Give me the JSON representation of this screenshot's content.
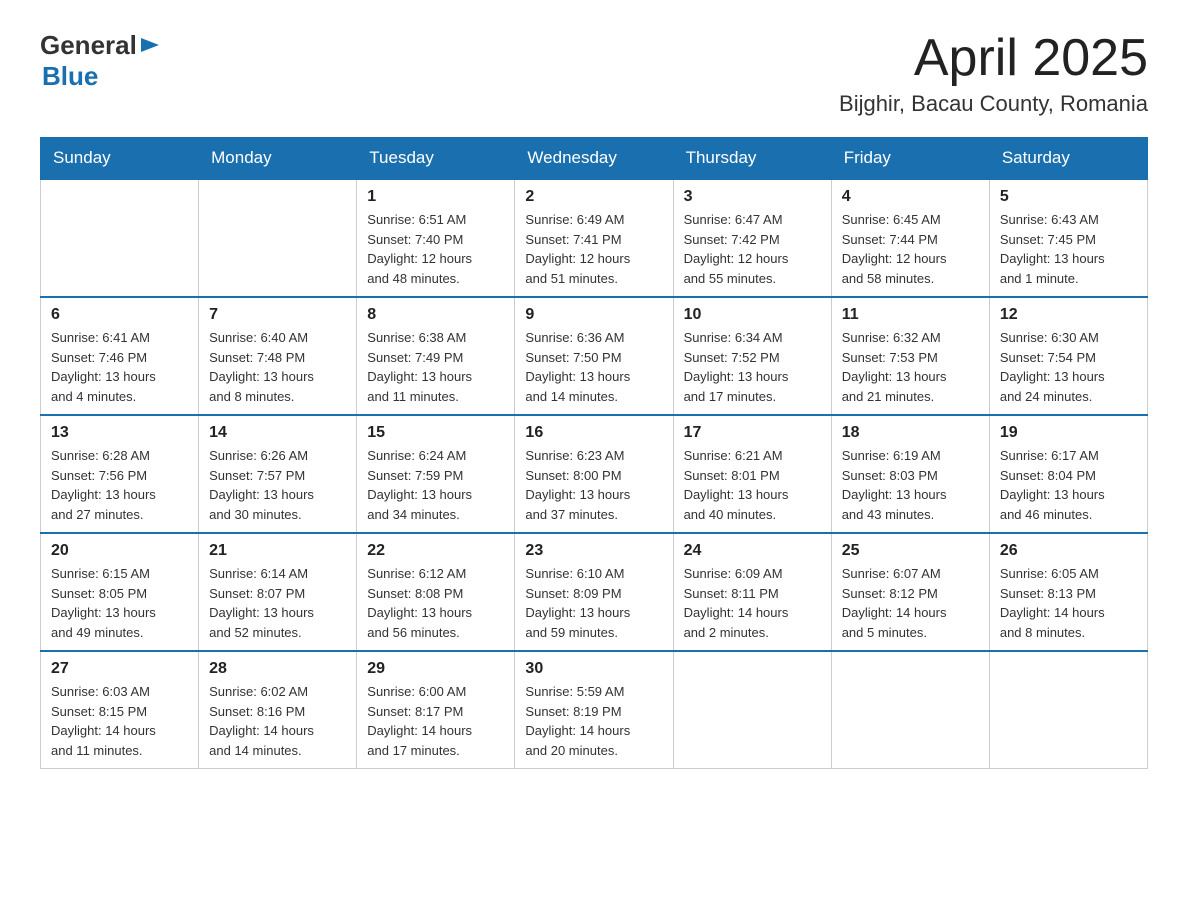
{
  "header": {
    "logo": {
      "general": "General",
      "blue": "Blue"
    },
    "title": "April 2025",
    "location": "Bijghir, Bacau County, Romania"
  },
  "days_of_week": [
    "Sunday",
    "Monday",
    "Tuesday",
    "Wednesday",
    "Thursday",
    "Friday",
    "Saturday"
  ],
  "weeks": [
    {
      "days": [
        {
          "num": "",
          "info": ""
        },
        {
          "num": "",
          "info": ""
        },
        {
          "num": "1",
          "info": "Sunrise: 6:51 AM\nSunset: 7:40 PM\nDaylight: 12 hours\nand 48 minutes."
        },
        {
          "num": "2",
          "info": "Sunrise: 6:49 AM\nSunset: 7:41 PM\nDaylight: 12 hours\nand 51 minutes."
        },
        {
          "num": "3",
          "info": "Sunrise: 6:47 AM\nSunset: 7:42 PM\nDaylight: 12 hours\nand 55 minutes."
        },
        {
          "num": "4",
          "info": "Sunrise: 6:45 AM\nSunset: 7:44 PM\nDaylight: 12 hours\nand 58 minutes."
        },
        {
          "num": "5",
          "info": "Sunrise: 6:43 AM\nSunset: 7:45 PM\nDaylight: 13 hours\nand 1 minute."
        }
      ]
    },
    {
      "days": [
        {
          "num": "6",
          "info": "Sunrise: 6:41 AM\nSunset: 7:46 PM\nDaylight: 13 hours\nand 4 minutes."
        },
        {
          "num": "7",
          "info": "Sunrise: 6:40 AM\nSunset: 7:48 PM\nDaylight: 13 hours\nand 8 minutes."
        },
        {
          "num": "8",
          "info": "Sunrise: 6:38 AM\nSunset: 7:49 PM\nDaylight: 13 hours\nand 11 minutes."
        },
        {
          "num": "9",
          "info": "Sunrise: 6:36 AM\nSunset: 7:50 PM\nDaylight: 13 hours\nand 14 minutes."
        },
        {
          "num": "10",
          "info": "Sunrise: 6:34 AM\nSunset: 7:52 PM\nDaylight: 13 hours\nand 17 minutes."
        },
        {
          "num": "11",
          "info": "Sunrise: 6:32 AM\nSunset: 7:53 PM\nDaylight: 13 hours\nand 21 minutes."
        },
        {
          "num": "12",
          "info": "Sunrise: 6:30 AM\nSunset: 7:54 PM\nDaylight: 13 hours\nand 24 minutes."
        }
      ]
    },
    {
      "days": [
        {
          "num": "13",
          "info": "Sunrise: 6:28 AM\nSunset: 7:56 PM\nDaylight: 13 hours\nand 27 minutes."
        },
        {
          "num": "14",
          "info": "Sunrise: 6:26 AM\nSunset: 7:57 PM\nDaylight: 13 hours\nand 30 minutes."
        },
        {
          "num": "15",
          "info": "Sunrise: 6:24 AM\nSunset: 7:59 PM\nDaylight: 13 hours\nand 34 minutes."
        },
        {
          "num": "16",
          "info": "Sunrise: 6:23 AM\nSunset: 8:00 PM\nDaylight: 13 hours\nand 37 minutes."
        },
        {
          "num": "17",
          "info": "Sunrise: 6:21 AM\nSunset: 8:01 PM\nDaylight: 13 hours\nand 40 minutes."
        },
        {
          "num": "18",
          "info": "Sunrise: 6:19 AM\nSunset: 8:03 PM\nDaylight: 13 hours\nand 43 minutes."
        },
        {
          "num": "19",
          "info": "Sunrise: 6:17 AM\nSunset: 8:04 PM\nDaylight: 13 hours\nand 46 minutes."
        }
      ]
    },
    {
      "days": [
        {
          "num": "20",
          "info": "Sunrise: 6:15 AM\nSunset: 8:05 PM\nDaylight: 13 hours\nand 49 minutes."
        },
        {
          "num": "21",
          "info": "Sunrise: 6:14 AM\nSunset: 8:07 PM\nDaylight: 13 hours\nand 52 minutes."
        },
        {
          "num": "22",
          "info": "Sunrise: 6:12 AM\nSunset: 8:08 PM\nDaylight: 13 hours\nand 56 minutes."
        },
        {
          "num": "23",
          "info": "Sunrise: 6:10 AM\nSunset: 8:09 PM\nDaylight: 13 hours\nand 59 minutes."
        },
        {
          "num": "24",
          "info": "Sunrise: 6:09 AM\nSunset: 8:11 PM\nDaylight: 14 hours\nand 2 minutes."
        },
        {
          "num": "25",
          "info": "Sunrise: 6:07 AM\nSunset: 8:12 PM\nDaylight: 14 hours\nand 5 minutes."
        },
        {
          "num": "26",
          "info": "Sunrise: 6:05 AM\nSunset: 8:13 PM\nDaylight: 14 hours\nand 8 minutes."
        }
      ]
    },
    {
      "days": [
        {
          "num": "27",
          "info": "Sunrise: 6:03 AM\nSunset: 8:15 PM\nDaylight: 14 hours\nand 11 minutes."
        },
        {
          "num": "28",
          "info": "Sunrise: 6:02 AM\nSunset: 8:16 PM\nDaylight: 14 hours\nand 14 minutes."
        },
        {
          "num": "29",
          "info": "Sunrise: 6:00 AM\nSunset: 8:17 PM\nDaylight: 14 hours\nand 17 minutes."
        },
        {
          "num": "30",
          "info": "Sunrise: 5:59 AM\nSunset: 8:19 PM\nDaylight: 14 hours\nand 20 minutes."
        },
        {
          "num": "",
          "info": ""
        },
        {
          "num": "",
          "info": ""
        },
        {
          "num": "",
          "info": ""
        }
      ]
    }
  ]
}
